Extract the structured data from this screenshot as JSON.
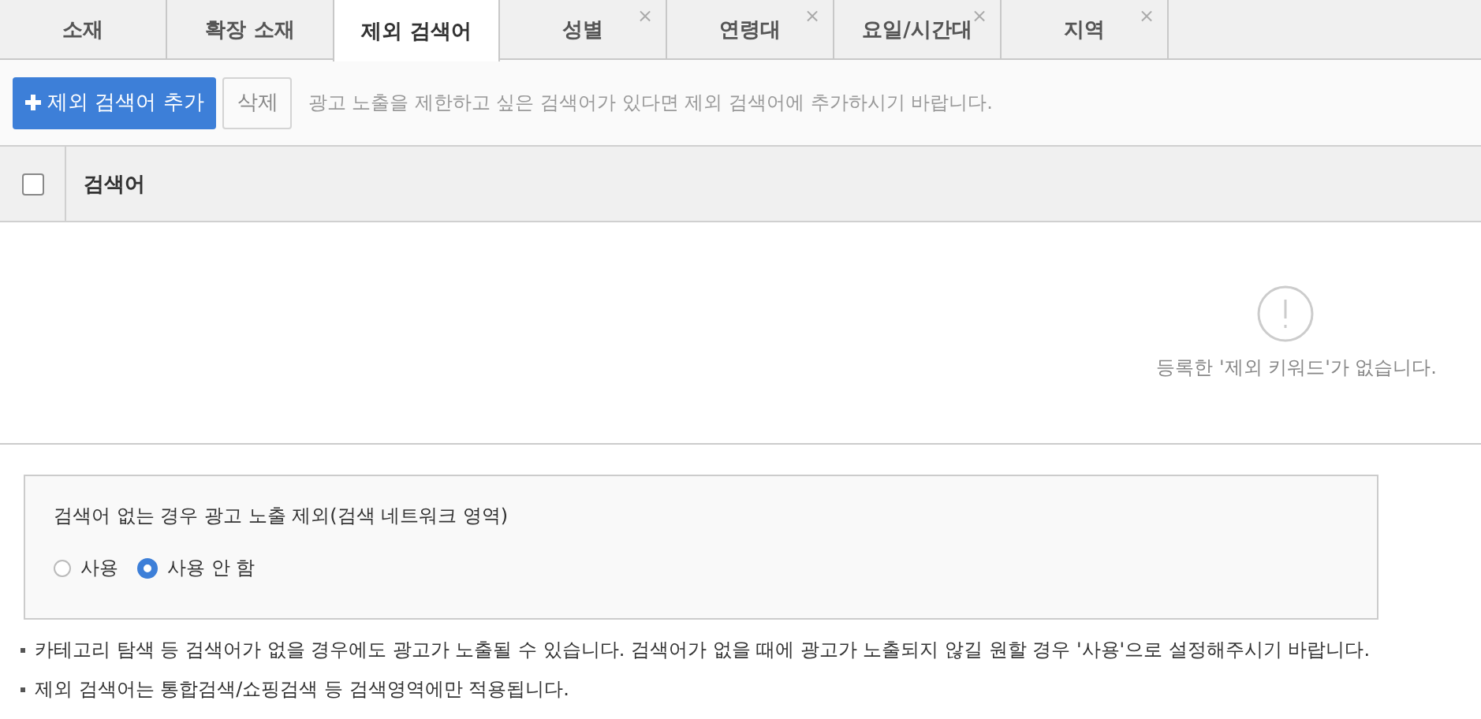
{
  "tabs": [
    {
      "label": "소재",
      "selected": false,
      "closable": false
    },
    {
      "label": "확장 소재",
      "selected": false,
      "closable": false
    },
    {
      "label": "제외 검색어",
      "selected": true,
      "closable": false
    },
    {
      "label": "성별",
      "selected": false,
      "closable": true
    },
    {
      "label": "연령대",
      "selected": false,
      "closable": true
    },
    {
      "label": "요일/시간대",
      "selected": false,
      "closable": true
    },
    {
      "label": "지역",
      "selected": false,
      "closable": true
    }
  ],
  "tab_close_symbol": "×",
  "toolbar": {
    "add_button": "제외 검색어 추가",
    "delete_button": "삭제",
    "hint": "광고 노출을 제한하고 싶은 검색어가 있다면 제외 검색어에 추가하시기 바랍니다."
  },
  "table": {
    "select_all_checked": false,
    "columns": [
      "검색어"
    ],
    "empty_message": "등록한 '제외 키워드'가 없습니다."
  },
  "setting": {
    "title": "검색어 없는 경우 광고 노출 제외(검색 네트워크 영역)",
    "options": [
      {
        "label": "사용",
        "selected": false
      },
      {
        "label": "사용 안 함",
        "selected": true
      }
    ]
  },
  "notes": [
    "카테고리 탐색 등 검색어가 없을 경우에도 광고가 노출될 수 있습니다. 검색어가 없을 때에 광고가 노출되지 않길 원할 경우 '사용'으로 설정해주시기 바랍니다.",
    "제외 검색어는 통합검색/쇼핑검색 등 검색영역에만 적용됩니다."
  ]
}
